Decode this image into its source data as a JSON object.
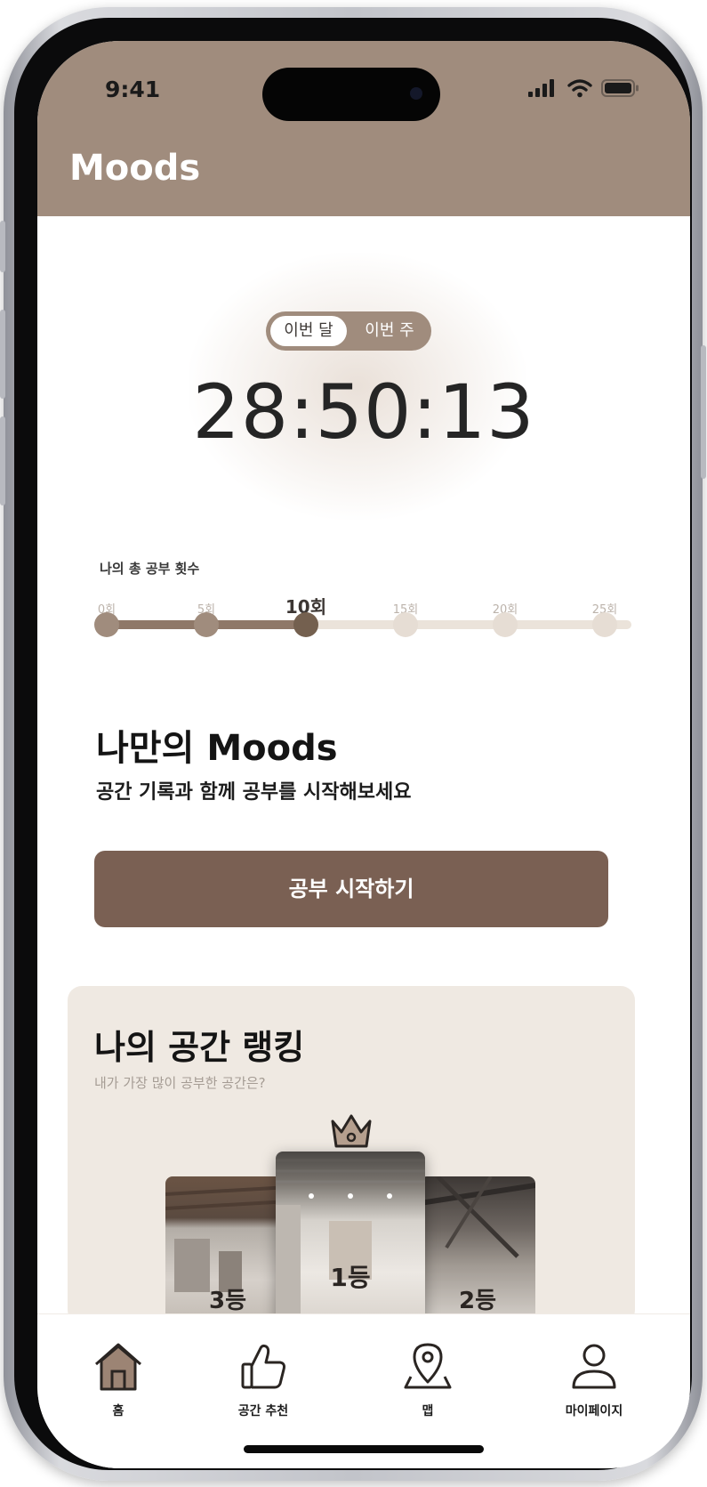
{
  "status_bar": {
    "time": "9:41"
  },
  "header": {
    "title": "Moods"
  },
  "period_toggle": {
    "selected": "이번 달",
    "other": "이번 주"
  },
  "timer": {
    "value": "28:50:13"
  },
  "study_progress": {
    "label": "나의 총 공부 횟수",
    "ticks": [
      "0회",
      "5회",
      "10회",
      "15회",
      "20회",
      "25회"
    ],
    "current_tick_index": 2
  },
  "my_moods": {
    "title": "나만의 Moods",
    "subtitle": "공간 기록과 함께 공부를 시작해보세요",
    "start_button": "공부 시작하기"
  },
  "ranking": {
    "title": "나의 공간 랭킹",
    "subtitle": "내가 가장 많이 공부한 공간은?",
    "first": "1등",
    "second": "2등",
    "third": "3등"
  },
  "tabbar": {
    "home": "홈",
    "recommend": "공간 추천",
    "map": "맵",
    "mypage": "마이페이지"
  },
  "colors": {
    "header": "#a08c7d",
    "primary_button": "#7a6053",
    "progress_fill": "#8f7868",
    "progress_track": "#ebe3da",
    "card_background": "#efe9e2"
  }
}
